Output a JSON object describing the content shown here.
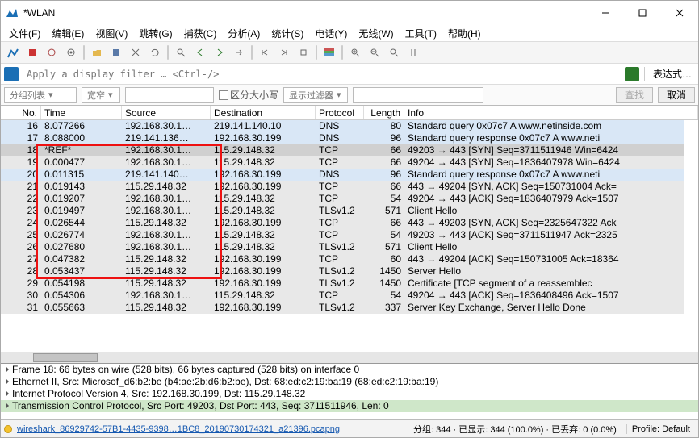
{
  "window": {
    "title": "*WLAN"
  },
  "menus": [
    "文件(F)",
    "编辑(E)",
    "视图(V)",
    "跳转(G)",
    "捕获(C)",
    "分析(A)",
    "统计(S)",
    "电话(Y)",
    "无线(W)",
    "工具(T)",
    "帮助(H)"
  ],
  "filter": {
    "placeholder": "Apply a display filter … <Ctrl-/>",
    "expression": "表达式…"
  },
  "searchbar": {
    "scope": "分组列表",
    "type": "宽窄",
    "casebox": "区分大小写",
    "filterbtn": "显示过滤器",
    "find": "查找",
    "cancel": "取消"
  },
  "columns": {
    "no": "No.",
    "time": "Time",
    "source": "Source",
    "destination": "Destination",
    "protocol": "Protocol",
    "length": "Length",
    "info": "Info"
  },
  "packets": [
    {
      "no": "16",
      "time": "8.077266",
      "src": "192.168.30.1…",
      "dst": "219.141.140.10",
      "proto": "DNS",
      "len": "80",
      "info": "Standard query 0x07c7 A www.netinside.com",
      "bg": "bg-dns"
    },
    {
      "no": "17",
      "time": "8.088000",
      "src": "219.141.136…",
      "dst": "192.168.30.199",
      "proto": "DNS",
      "len": "96",
      "info": "Standard query response 0x07c7 A www.neti",
      "bg": "bg-dns"
    },
    {
      "no": "18",
      "time": "*REF*",
      "src": "192.168.30.1…",
      "dst": "115.29.148.32",
      "proto": "TCP",
      "len": "66",
      "info": "49203 → 443 [SYN] Seq=3711511946 Win=6424",
      "bg": "bg-sel"
    },
    {
      "no": "19",
      "time": "0.000477",
      "src": "192.168.30.1…",
      "dst": "115.29.148.32",
      "proto": "TCP",
      "len": "66",
      "info": "49204 → 443 [SYN] Seq=1836407978 Win=6424",
      "bg": "bg-tcp1"
    },
    {
      "no": "20",
      "time": "0.011315",
      "src": "219.141.140…",
      "dst": "192.168.30.199",
      "proto": "DNS",
      "len": "96",
      "info": "Standard query response 0x07c7 A www.neti",
      "bg": "bg-dns"
    },
    {
      "no": "21",
      "time": "0.019143",
      "src": "115.29.148.32",
      "dst": "192.168.30.199",
      "proto": "TCP",
      "len": "66",
      "info": "443 → 49204 [SYN, ACK] Seq=150731004 Ack=",
      "bg": "bg-tcp1"
    },
    {
      "no": "22",
      "time": "0.019207",
      "src": "192.168.30.1…",
      "dst": "115.29.148.32",
      "proto": "TCP",
      "len": "54",
      "info": "49204 → 443 [ACK] Seq=1836407979 Ack=1507",
      "bg": "bg-tcp1"
    },
    {
      "no": "23",
      "time": "0.019497",
      "src": "192.168.30.1…",
      "dst": "115.29.148.32",
      "proto": "TLSv1.2",
      "len": "571",
      "info": "Client Hello",
      "bg": "bg-tcp1"
    },
    {
      "no": "24",
      "time": "0.026544",
      "src": "115.29.148.32",
      "dst": "192.168.30.199",
      "proto": "TCP",
      "len": "66",
      "info": "443 → 49203 [SYN, ACK] Seq=2325647322 Ack",
      "bg": "bg-tcp1"
    },
    {
      "no": "25",
      "time": "0.026774",
      "src": "192.168.30.1…",
      "dst": "115.29.148.32",
      "proto": "TCP",
      "len": "54",
      "info": "49203 → 443 [ACK] Seq=3711511947 Ack=2325",
      "bg": "bg-tcp1"
    },
    {
      "no": "26",
      "time": "0.027680",
      "src": "192.168.30.1…",
      "dst": "115.29.148.32",
      "proto": "TLSv1.2",
      "len": "571",
      "info": "Client Hello",
      "bg": "bg-tcp1"
    },
    {
      "no": "27",
      "time": "0.047382",
      "src": "115.29.148.32",
      "dst": "192.168.30.199",
      "proto": "TCP",
      "len": "60",
      "info": "443 → 49204 [ACK] Seq=150731005 Ack=18364",
      "bg": "bg-tcp1"
    },
    {
      "no": "28",
      "time": "0.053437",
      "src": "115.29.148.32",
      "dst": "192.168.30.199",
      "proto": "TLSv1.2",
      "len": "1450",
      "info": "Server Hello",
      "bg": "bg-tcp1"
    },
    {
      "no": "29",
      "time": "0.054198",
      "src": "115.29.148.32",
      "dst": "192.168.30.199",
      "proto": "TLSv1.2",
      "len": "1450",
      "info": "Certificate [TCP segment of a reassemblec",
      "bg": "bg-tcp1"
    },
    {
      "no": "30",
      "time": "0.054306",
      "src": "192.168.30.1…",
      "dst": "115.29.148.32",
      "proto": "TCP",
      "len": "54",
      "info": "49204 → 443 [ACK] Seq=1836408496 Ack=1507",
      "bg": "bg-tcp1"
    },
    {
      "no": "31",
      "time": "0.055663",
      "src": "115.29.148.32",
      "dst": "192.168.30.199",
      "proto": "TLSv1.2",
      "len": "337",
      "info": "Server Key Exchange, Server Hello Done",
      "bg": "bg-tcp1"
    }
  ],
  "details": [
    "Frame 18: 66 bytes on wire (528 bits), 66 bytes captured (528 bits) on interface 0",
    "Ethernet II, Src: Microsof_d6:b2:be (b4:ae:2b:d6:b2:be), Dst: 68:ed:c2:19:ba:19 (68:ed:c2:19:ba:19)",
    "Internet Protocol Version 4, Src: 192.168.30.199, Dst: 115.29.148.32",
    "Transmission Control Protocol, Src Port: 49203, Dst Port: 443, Seq: 3711511946, Len: 0"
  ],
  "status": {
    "file": "wireshark_86929742-57B1-4435-9398…1BC8_20190730174321_a21396.pcapng",
    "stats": "分组: 344 · 已显示: 344 (100.0%) · 已丢弃: 0 (0.0%)",
    "profile": "Profile: Default"
  }
}
